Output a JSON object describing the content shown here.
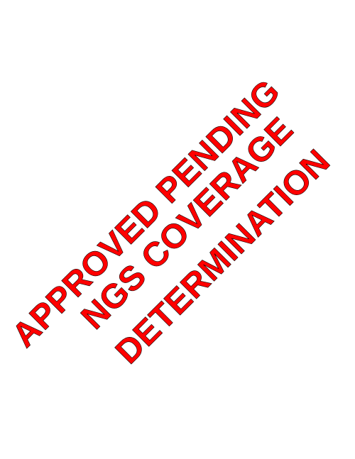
{
  "stamp": {
    "lines": [
      "APPROVED PENDING",
      "NGS COVERAGE",
      "DETERMINATION"
    ],
    "color": "#ff0000",
    "outline_color": "#000000",
    "background": "#ffffff"
  }
}
